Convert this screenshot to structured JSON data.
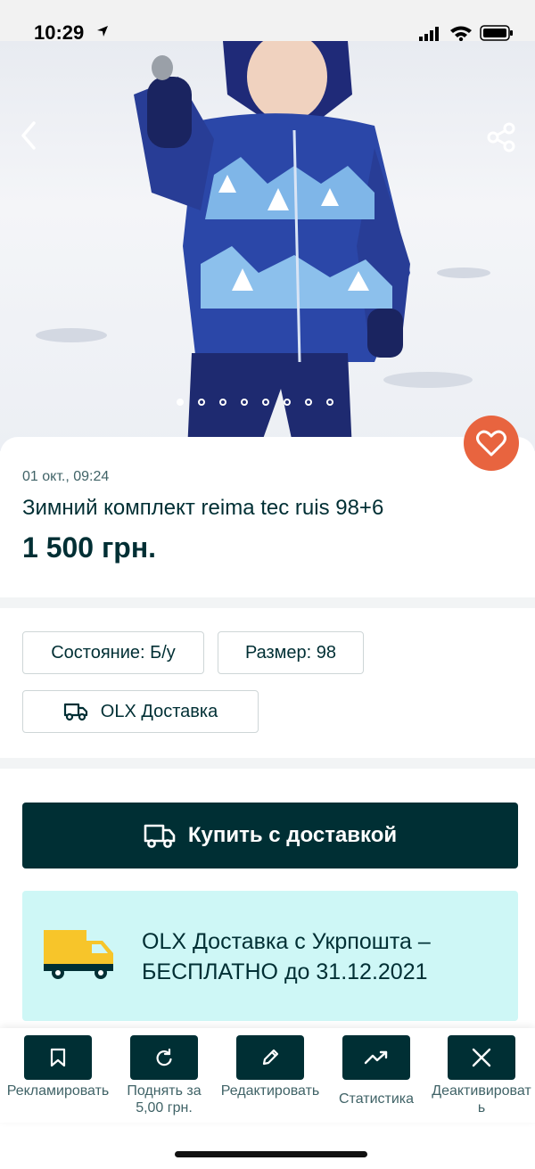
{
  "status_bar": {
    "time": "10:29"
  },
  "photo": {
    "slides_total": 8,
    "active_slide": 1
  },
  "listing": {
    "date": "01 окт., 09:24",
    "title": "Зимний комплект reima tec ruis 98+6",
    "price": "1 500 грн."
  },
  "attributes": {
    "condition": "Состояние: Б/у",
    "size": "Размер: 98",
    "delivery": "OLX Доставка"
  },
  "buy_button": {
    "label": "Купить с доставкой"
  },
  "promo": {
    "text": "OLX Доставка с Укрпошта – БЕСПЛАТНО до 31.12.2021"
  },
  "actions": [
    {
      "label": "Рекламировать",
      "icon": "bookmark-icon"
    },
    {
      "label": "Поднять за 5,00 грн.",
      "icon": "refresh-icon"
    },
    {
      "label": "Редактировать",
      "icon": "pencil-icon"
    },
    {
      "label": "Статистика",
      "icon": "trend-icon"
    },
    {
      "label": "Деактивировать",
      "icon": "close-icon"
    }
  ],
  "colors": {
    "brand_dark": "#002f34",
    "favorite": "#e8643f",
    "promo_bg": "#cef7f6",
    "secondary_text": "#406367"
  }
}
